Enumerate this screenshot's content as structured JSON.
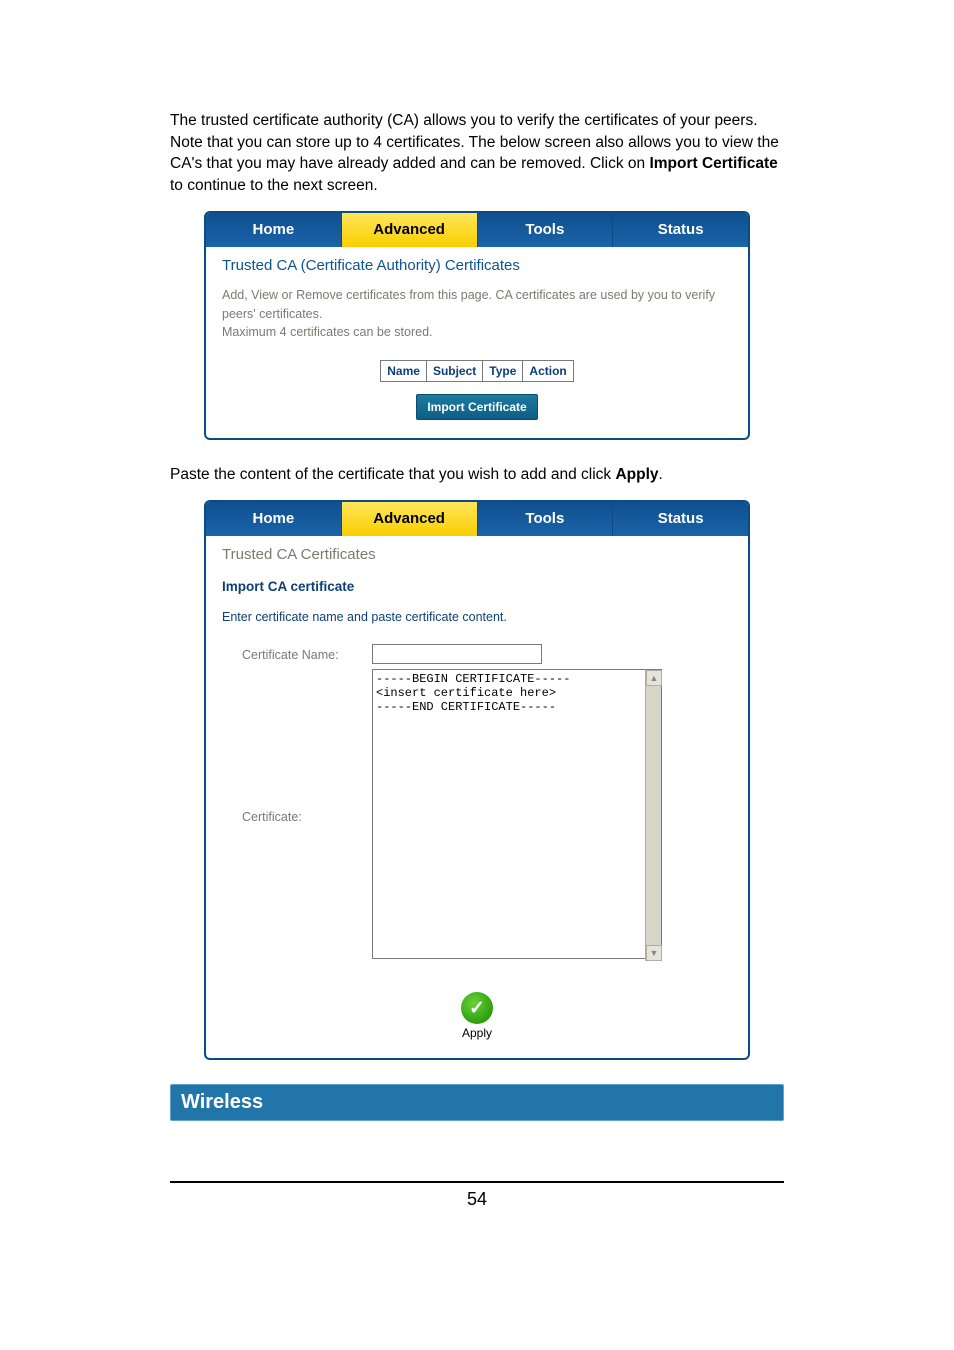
{
  "paragraph1_parts": {
    "p1": "The trusted certificate authority (CA) allows you to verify the certificates of your peers. Note that you can store up to 4 certificates. The below screen also allows you to view the CA's that you may have already added and can be removed. Click on ",
    "bold": "Import Certificate",
    "p2": " to continue to the next screen."
  },
  "tabs": {
    "home": "Home",
    "advanced": "Advanced",
    "tools": "Tools",
    "status": "Status"
  },
  "panel1": {
    "title": "Trusted CA (Certificate Authority) Certificates",
    "desc1": "Add, View or Remove certificates from this page. CA certificates are used by you to verify peers' certificates.",
    "desc2": "Maximum 4 certificates can be stored.",
    "cols": {
      "c1": "Name",
      "c2": "Subject",
      "c3": "Type",
      "c4": "Action"
    },
    "import_btn": "Import Certificate"
  },
  "paragraph2_parts": {
    "p1": "Paste the content of the certificate that you wish to add and click ",
    "bold": "Apply",
    "p2": "."
  },
  "panel2": {
    "title": "Trusted CA Certificates",
    "subtitle": "Import CA certificate",
    "desc": "Enter certificate name and paste certificate content.",
    "name_label": "Certificate Name:",
    "cert_label": "Certificate:",
    "cert_placeholder": "-----BEGIN CERTIFICATE-----\n<insert certificate here>\n-----END CERTIFICATE-----",
    "apply": "Apply"
  },
  "section_heading": "Wireless",
  "page_number": "54"
}
